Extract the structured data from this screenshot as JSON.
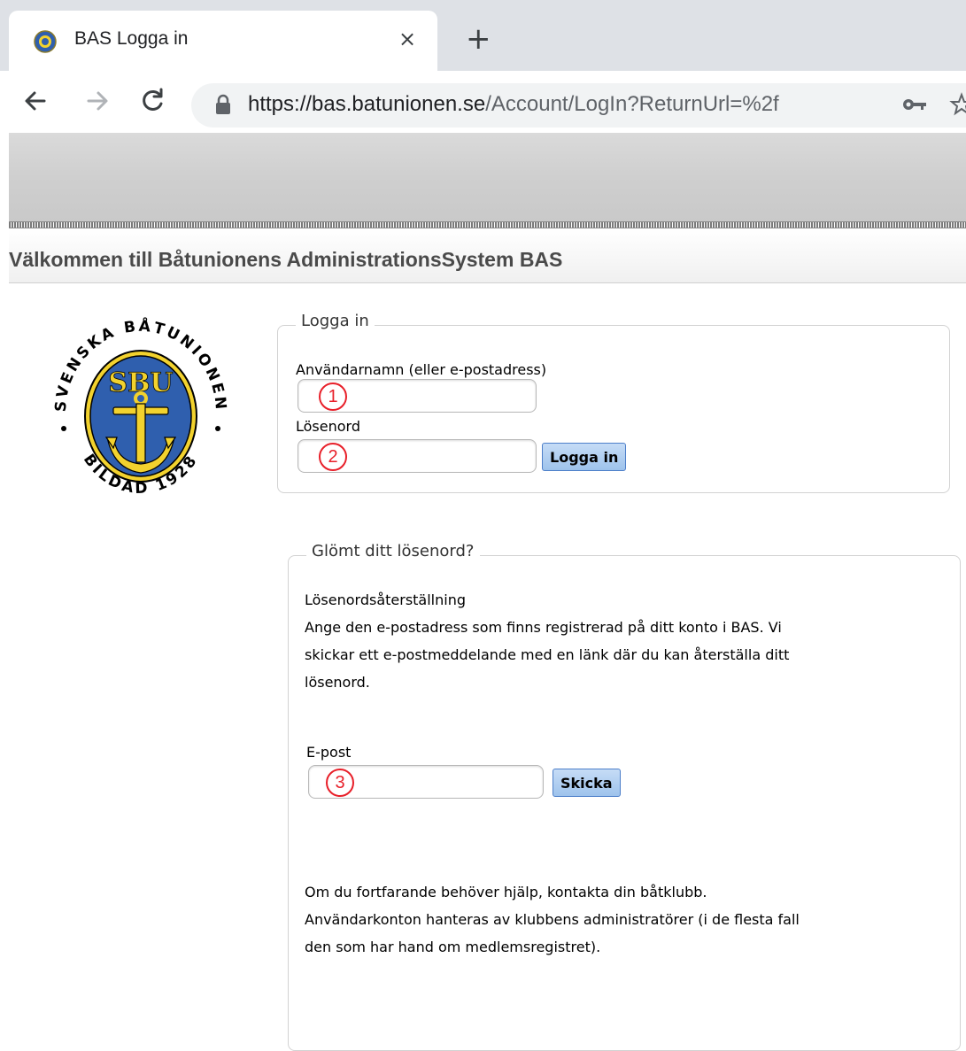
{
  "browser": {
    "tab_title": "BAS Logga in",
    "tab_close": "×",
    "new_tab": "+",
    "url_host": "https://bas.batunionen.se",
    "url_path": "/Account/LogIn?ReturnUrl=%2f"
  },
  "page": {
    "welcome_title": "Välkommen till Båtunionens AdministrationsSystem BAS"
  },
  "logo": {
    "initials": "SBU",
    "ring_text_top": "SVENSKA BÅTUNIONEN",
    "ring_text_bottom": "BILDAD 1928"
  },
  "login": {
    "legend": "Logga in",
    "username_label": "Användarnamn (eller e-postadress)",
    "username_value": "",
    "password_label": "Lösenord",
    "password_value": "",
    "submit_label": "Logga in",
    "marker_1": "1",
    "marker_2": "2"
  },
  "forgot": {
    "legend": "Glömt ditt lösenord?",
    "heading": "Lösenordsåterställning",
    "description_lines": [
      "Ange den e-postadress som finns registrerad på ditt konto i BAS. Vi",
      "skickar ett e-postmeddelande med en länk där du kan återställa ditt",
      "lösenord."
    ],
    "email_label": "E-post",
    "email_value": "",
    "submit_label": "Skicka",
    "marker_3": "3",
    "help_lines": [
      "Om du fortfarande behöver hjälp, kontakta din båtklubb.",
      "Användarkonton hanteras av klubbens administratörer (i de flesta fall",
      "den som har hand om medlemsregistret)."
    ]
  },
  "colors": {
    "marker": "#e8202a",
    "button_top": "#c6dcf6",
    "button_bottom": "#9ec3ec",
    "logo_blue": "#2f5fae",
    "logo_gold": "#f2d22e"
  }
}
